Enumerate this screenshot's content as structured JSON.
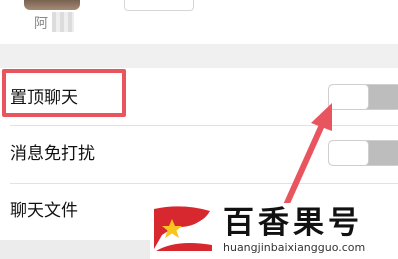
{
  "contact": {
    "name": "阿"
  },
  "settings": {
    "rows": [
      {
        "label": "置顶聊天",
        "toggle_on": false
      },
      {
        "label": "消息免打扰",
        "toggle_on": false
      },
      {
        "label": "聊天文件"
      }
    ]
  },
  "watermark": {
    "title": "百香果号",
    "url": "huangjinbaixiangguo.com"
  },
  "colors": {
    "highlight": "#e8555e",
    "arrow": "#e8555e",
    "logo_red": "#d7282f",
    "logo_star": "#f7c51e"
  }
}
